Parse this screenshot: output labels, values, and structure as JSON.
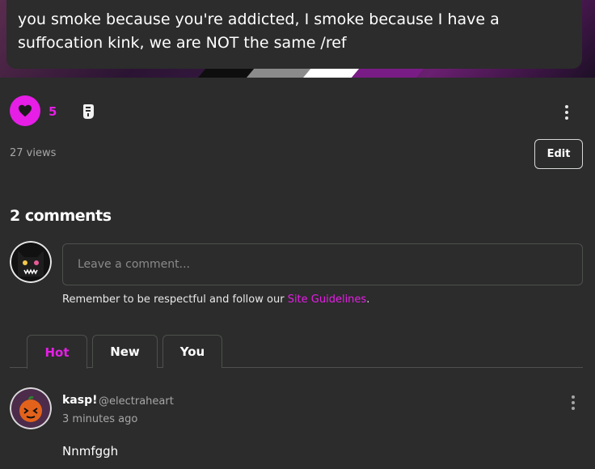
{
  "post": {
    "text": "you smoke because you're addicted, I smoke because I have a suffocation kink, we are NOT the same /ref",
    "like_count": "5",
    "views": "27 views",
    "edit_label": "Edit"
  },
  "comments": {
    "heading": "2 comments",
    "input_placeholder": "Leave a comment...",
    "guidelines_prefix": "Remember to be respectful and follow our ",
    "guidelines_link": "Site Guidelines",
    "guidelines_suffix": ".",
    "tabs": [
      {
        "label": "Hot",
        "active": true
      },
      {
        "label": "New",
        "active": false
      },
      {
        "label": "You",
        "active": false
      }
    ],
    "items": [
      {
        "name": "kasp!",
        "handle": "@electraheart",
        "time": "3 minutes ago",
        "text": "Nnmfggh"
      }
    ]
  },
  "colors": {
    "accent": "#e61ee6",
    "background": "#2b2c2b",
    "muted_text": "#a6a6a6",
    "border": "#4e504e"
  },
  "icons": {
    "like": "heart-icon",
    "reblog": "reblog-icon",
    "more": "more-vertical-icon"
  }
}
